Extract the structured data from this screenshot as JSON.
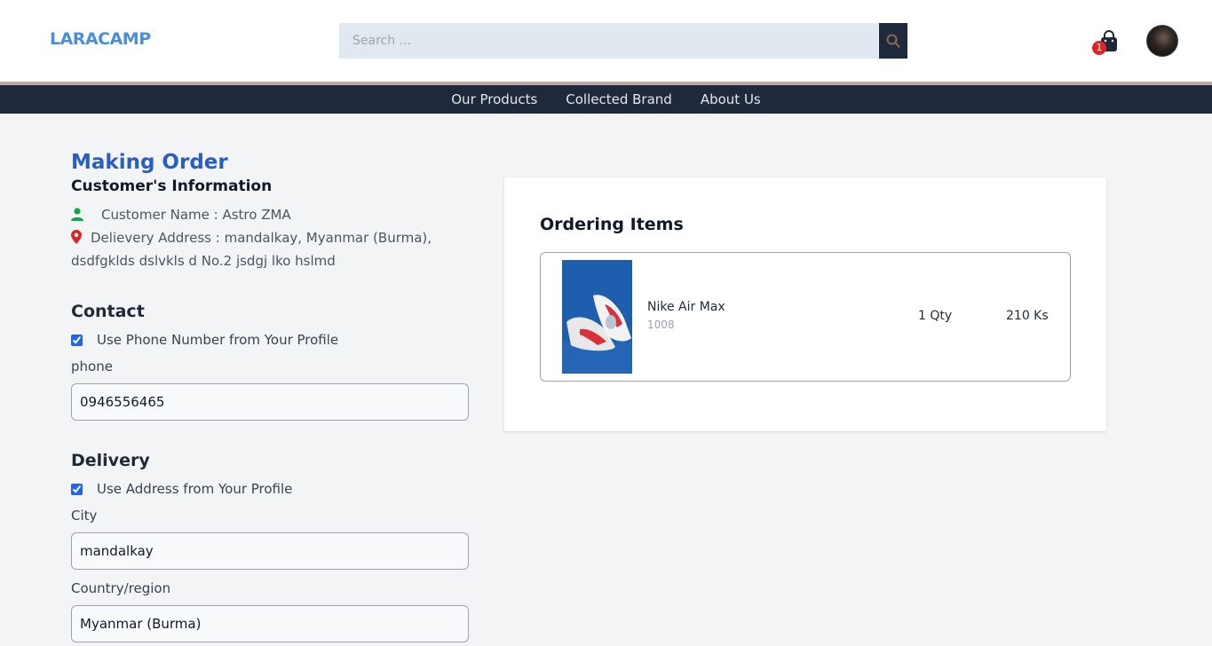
{
  "header": {
    "brand": "LARACAMP",
    "search_placeholder": "Search ...",
    "cart_count": "1"
  },
  "nav": {
    "items": [
      {
        "label": "Our Products"
      },
      {
        "label": "Collected Brand"
      },
      {
        "label": "About Us"
      }
    ]
  },
  "order": {
    "title": "Making Order",
    "customer_heading": "Customer's Information",
    "customer_name": "Customer Name : Astro ZMA",
    "delivery_address": "Delievery Address : mandalkay, Myanmar (Burma), dsdfgklds dslvkls d No.2 jsdgj lko hslmd"
  },
  "contact": {
    "heading": "Contact",
    "use_profile_phone_label": "Use Phone Number from Your Profile",
    "use_profile_phone_checked": true,
    "phone_label": "phone",
    "phone_value": "0946556465"
  },
  "delivery": {
    "heading": "Delivery",
    "use_profile_address_label": "Use Address from Your Profile",
    "use_profile_address_checked": true,
    "city_label": "City",
    "city_value": "mandalkay",
    "country_label": "Country/region",
    "country_value": "Myanmar (Burma)"
  },
  "ordering": {
    "heading": "Ordering Items",
    "items": [
      {
        "name": "Nike Air Max",
        "code": "1008",
        "qty": "1 Qty",
        "price": "210 Ks"
      }
    ]
  },
  "colors": {
    "brand": "#4a8fdc",
    "title": "#2a5ebd",
    "nav_bg": "#1e293b",
    "user_icon": "#16a34a",
    "pin_icon": "#dc2626",
    "badge": "#dc2626"
  },
  "icons": {
    "search": "search-icon",
    "cart": "shopping-bag-icon",
    "user": "user-icon",
    "location": "map-pin-icon"
  }
}
